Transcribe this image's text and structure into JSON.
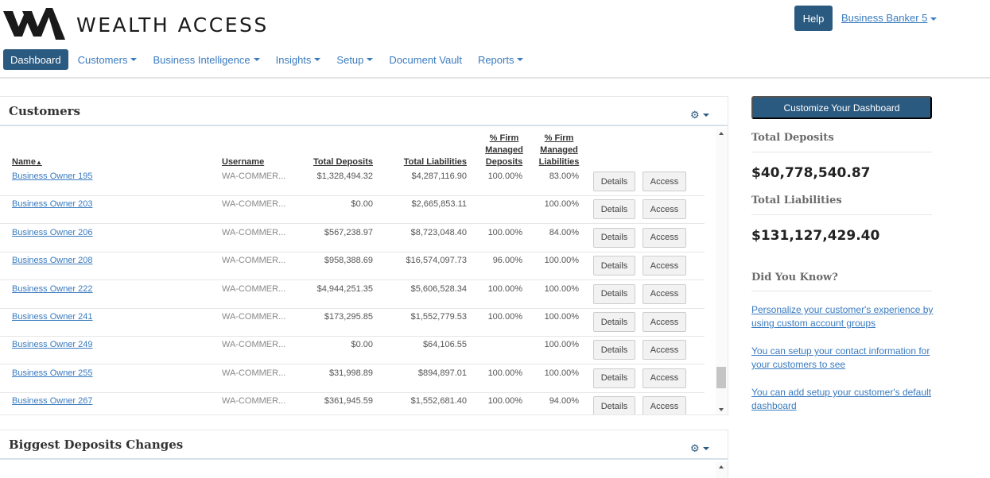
{
  "header": {
    "brand": "WEALTH ACCESS",
    "help_label": "Help",
    "user_label": "Business Banker 5"
  },
  "nav": [
    {
      "label": "Dashboard",
      "active": true,
      "dropdown": false
    },
    {
      "label": "Customers",
      "dropdown": true
    },
    {
      "label": "Business Intelligence",
      "dropdown": true
    },
    {
      "label": "Insights",
      "dropdown": true
    },
    {
      "label": "Setup",
      "dropdown": true
    },
    {
      "label": "Document Vault",
      "dropdown": false
    },
    {
      "label": "Reports",
      "dropdown": true
    }
  ],
  "customers_panel": {
    "title": "Customers",
    "columns": {
      "name": "Name",
      "username": "Username",
      "total_deposits": "Total Deposits",
      "total_liabilities": "Total Liabilities",
      "pct_deposits": [
        "% Firm",
        "Managed",
        "Deposits"
      ],
      "pct_liabilities": [
        "% Firm",
        "Managed",
        "Liabilities"
      ]
    },
    "details_label": "Details",
    "access_label": "Access",
    "rows": [
      {
        "name": "Business Owner 195",
        "username": "WA-COMMER...",
        "deposits": "$1,328,494.32",
        "liabilities": "$4,287,116.90",
        "pct_dep": "100.00%",
        "pct_liab": "83.00%"
      },
      {
        "name": "Business Owner 203",
        "username": "WA-COMMER...",
        "deposits": "$0.00",
        "liabilities": "$2,665,853.11",
        "pct_dep": "",
        "pct_liab": "100.00%"
      },
      {
        "name": "Business Owner 206",
        "username": "WA-COMMER...",
        "deposits": "$567,238.97",
        "liabilities": "$8,723,048.40",
        "pct_dep": "100.00%",
        "pct_liab": "84.00%"
      },
      {
        "name": "Business Owner 208",
        "username": "WA-COMMER...",
        "deposits": "$958,388.69",
        "liabilities": "$16,574,097.73",
        "pct_dep": "96.00%",
        "pct_liab": "100.00%"
      },
      {
        "name": "Business Owner 222",
        "username": "WA-COMMER...",
        "deposits": "$4,944,251.35",
        "liabilities": "$5,606,528.34",
        "pct_dep": "100.00%",
        "pct_liab": "100.00%"
      },
      {
        "name": "Business Owner 241",
        "username": "WA-COMMER...",
        "deposits": "$173,295.85",
        "liabilities": "$1,552,779.53",
        "pct_dep": "100.00%",
        "pct_liab": "100.00%"
      },
      {
        "name": "Business Owner 249",
        "username": "WA-COMMER...",
        "deposits": "$0.00",
        "liabilities": "$64,106.55",
        "pct_dep": "",
        "pct_liab": "100.00%"
      },
      {
        "name": "Business Owner 255",
        "username": "WA-COMMER...",
        "deposits": "$31,998.89",
        "liabilities": "$894,897.01",
        "pct_dep": "100.00%",
        "pct_liab": "100.00%"
      },
      {
        "name": "Business Owner 267",
        "username": "WA-COMMER...",
        "deposits": "$361,945.59",
        "liabilities": "$1,552,681.40",
        "pct_dep": "100.00%",
        "pct_liab": "94.00%"
      }
    ]
  },
  "deposits_panel": {
    "title": "Biggest Deposits Changes"
  },
  "sidebar": {
    "customize_label": "Customize Your Dashboard",
    "total_deposits_label": "Total Deposits",
    "total_deposits_value": "$40,778,540.87",
    "total_liabilities_label": "Total Liabilities",
    "total_liabilities_value": "$131,127,429.40",
    "did_you_know_label": "Did You Know?",
    "tips": [
      "Personalize your customer's experience by using custom account groups",
      "You can setup your contact information for your customers to see",
      "You can add setup your customer's default dashboard"
    ]
  }
}
